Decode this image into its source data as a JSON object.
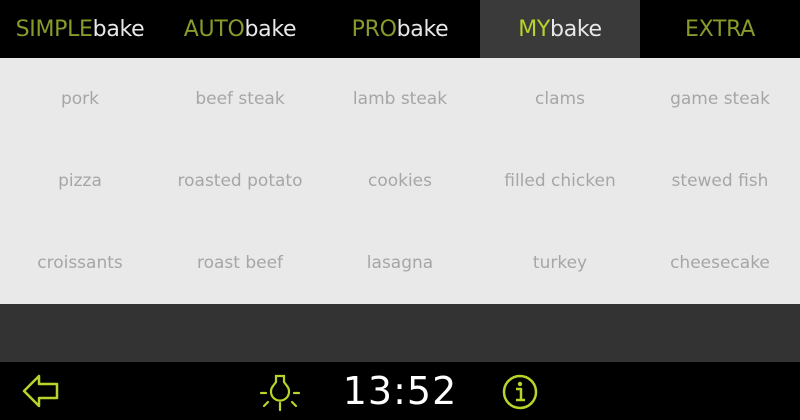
{
  "tabs": [
    {
      "prefix": "SIMPLE",
      "suffix": "bake"
    },
    {
      "prefix": "AUTO",
      "suffix": "bake"
    },
    {
      "prefix": "PRO",
      "suffix": "bake"
    },
    {
      "prefix": "MY",
      "suffix": "bake"
    },
    {
      "label": "EXTRA"
    }
  ],
  "active_tab": "MYbake",
  "recipes": [
    "pork",
    "beef steak",
    "lamb steak",
    "clams",
    "game steak",
    "pizza",
    "roasted potato",
    "cookies",
    "filled chicken",
    "stewed fish",
    "croissants",
    "roast beef",
    "lasagna",
    "turkey",
    "cheesecake"
  ],
  "footer": {
    "time": "13:52",
    "icons": {
      "back": "back-arrow-icon",
      "lamp": "oven-lamp-icon",
      "info": "info-icon"
    }
  },
  "colors": {
    "accent": "#b8d42a",
    "accent_dim": "#8a9a2a",
    "recipe_text": "#a6a6a6"
  }
}
